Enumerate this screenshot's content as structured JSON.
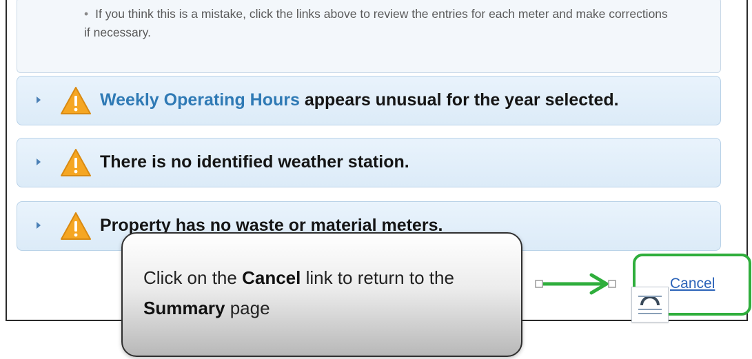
{
  "note": {
    "bullet": "•",
    "text": "If you think this is a mistake, click the links above to review the entries for each meter and make corrections if necessary."
  },
  "alerts": [
    {
      "link": "Weekly Operating Hours",
      "text": " appears unusual for the year selected.",
      "icon": "warning-icon"
    },
    {
      "link": "",
      "text": "There is no identified weather station.",
      "icon": "warning-icon"
    },
    {
      "link": "",
      "text": "Property has no waste or material meters.",
      "icon": "warning-icon"
    }
  ],
  "cancel": {
    "label": "Cancel"
  },
  "callout": {
    "part1": "Click on the ",
    "bold1": "Cancel",
    "part2": " link to return to the ",
    "bold2": "Summary",
    "part3": " page"
  },
  "colors": {
    "link": "#2f7ab5",
    "warning": "#f5a623",
    "highlight": "#2fae3c",
    "panel": "#dcebf8"
  }
}
